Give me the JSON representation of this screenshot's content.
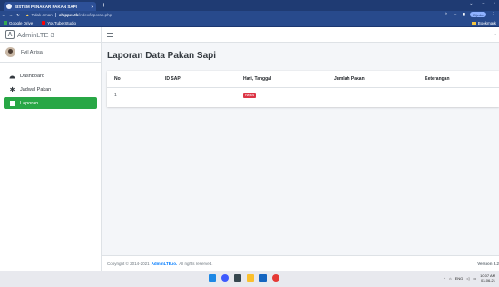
{
  "browser": {
    "tab_title": "SISTEM PENAKAR PAKAN SAPI",
    "tab_close": "×",
    "new_tab": "+",
    "not_secure": "Tidak aman",
    "url_host": "chipper.tk",
    "url_path": "/index/laporan.php",
    "profile_label": "Dijeda",
    "bookmarks": [
      {
        "label": "Google Drive",
        "color": "#34a853"
      },
      {
        "label": "YouTube Studio",
        "color": "#ff0000"
      }
    ],
    "bookmarks_right": "Bookmark"
  },
  "sidebar": {
    "brand": "AdminLTE 3",
    "user": "Fvil Afrisa",
    "items": [
      {
        "label": "Dashboard",
        "icon": "dashboard-icon",
        "active": false
      },
      {
        "label": "Jadwal Pakan",
        "icon": "gear-icon",
        "active": false
      },
      {
        "label": "Laporan",
        "icon": "file-icon",
        "active": true
      }
    ]
  },
  "main": {
    "title": "Laporan Data Pakan Sapi",
    "table": {
      "headers": [
        "No",
        "ID SAPI",
        "Hari, Tanggal",
        "Jumlah Pakan",
        "Keterangan"
      ],
      "rows": [
        {
          "no": "1",
          "id": "",
          "date": "",
          "amount": "",
          "note": "",
          "button": "Hapus"
        }
      ]
    }
  },
  "footer": {
    "copyright": "Copyright © 2014-2021",
    "brand": "AdminLTE.io.",
    "rights": "All rights reserved.",
    "version": "Version 3.2"
  },
  "taskbar": {
    "lang": "ENG",
    "time": "10:07 AM",
    "date": "03-06-21"
  },
  "colors": {
    "accent": "#28a745",
    "danger": "#dc3545",
    "link": "#007bff",
    "browser": "#1f3b73"
  }
}
